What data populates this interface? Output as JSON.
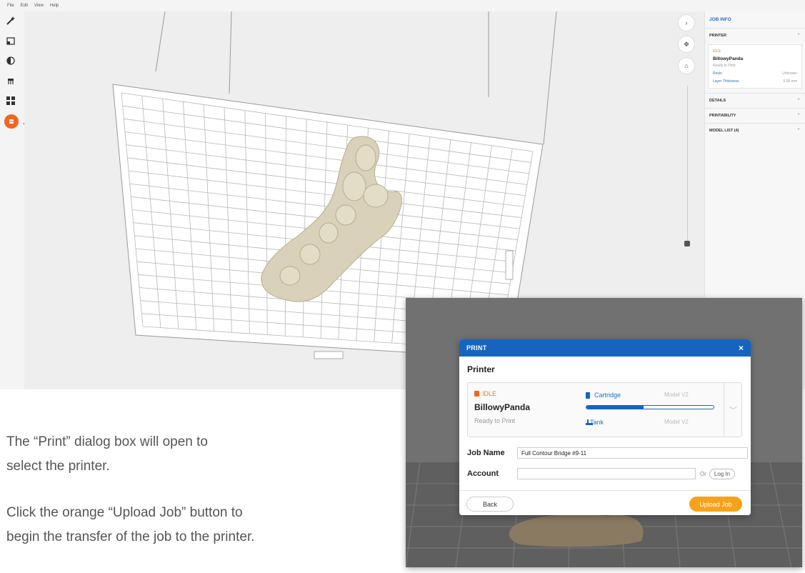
{
  "menubar": {
    "items": [
      "File",
      "Edit",
      "View",
      "Help"
    ]
  },
  "toolbar": {
    "icons": [
      "magic-wand-icon",
      "scale-icon",
      "orientation-icon",
      "supports-icon",
      "layout-icon",
      "print-icon"
    ]
  },
  "side_panel": {
    "title": "JOB INFO",
    "printer_section": "PRINTER",
    "printer_status": "IDLE",
    "printer_name": "BillowyPanda",
    "printer_ready": "Ready to Print",
    "rows": [
      {
        "label": "Resin",
        "value": "Unknown"
      },
      {
        "label": "Layer Thickness",
        "value": "0.05 mm"
      }
    ],
    "sections": [
      "DETAILS",
      "PRINTABILITY",
      "MODEL LIST (4)"
    ]
  },
  "instructions": {
    "line1": "The “Print” dialog box will open to",
    "line2": "select the printer.",
    "line3": "Click the orange “Upload Job” button to",
    "line4": "begin the transfer of the job to the printer."
  },
  "dialog": {
    "title": "PRINT",
    "close_label": "×",
    "section_label": "Printer",
    "status": "IDLE",
    "printer_name": "BillowyPanda",
    "printer_ready": "Ready to Print",
    "cartridge_label": "Cartridge",
    "cartridge_model": "Model V2",
    "cartridge_level": 0.45,
    "tank_label": "Tank",
    "tank_model": "Model V2",
    "job_name_label": "Job Name",
    "job_name_value": "Full Contour Bridge #9-11",
    "account_label": "Account",
    "or_label": "Or",
    "login_label": "Log In",
    "back_label": "Back",
    "upload_label": "Upload Job"
  },
  "colors": {
    "accent_blue": "#1565c0",
    "upload_orange": "#f7a21b",
    "arrow_red": "#d9261c",
    "active_tool": "#f26522"
  }
}
